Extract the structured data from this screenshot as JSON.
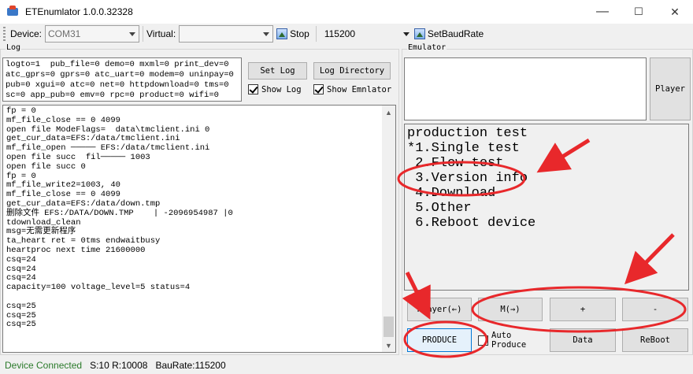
{
  "window": {
    "title": "ETEnumlator 1.0.0.32328",
    "minimize": "—",
    "maximize": "☐",
    "close": "✕"
  },
  "toolbar": {
    "device_label": "Device:",
    "device_value": "COM31",
    "virtual_label": "Virtual:",
    "virtual_value": "",
    "stop_label": "Stop",
    "baud_value": "115200",
    "set_baud_label": "SetBaudRate"
  },
  "log": {
    "group_title": "Log",
    "flags": "logto=1  pub_file=0 demo=0 mxml=0 print_dev=0\natc_gprs=0 gprs=0 atc_uart=0 modem=0 uninpay=0\npub=0 xgui=0 atc=0 net=0 httpdownload=0 tms=0\nsc=0 app_pub=0 emv=0 rpc=0 product=0 wifi=0",
    "set_log": "Set Log",
    "log_directory": "Log Directory",
    "show_log": "Show Log",
    "show_emulator": "Show Emnlator",
    "lines": "fp = 0\nmf_file_close == 0 4099\nopen file ModeFlags=  data\\tmclient.ini 0\nget_cur_data=EFS:/data/tmclient.ini\nmf_file_open ───── EFS:/data/tmclient.ini\nopen file succ  fil───── 1003\nopen file succ 0\nfp = 0\nmf_file_write2=1003, 40\nmf_file_close == 0 4099\nget_cur_data=EFS:/data/down.tmp\n删除文件 EFS:/DATA/DOWN.TMP    | -2096954987 |0\ntdownload_clean\nmsg=无需更新程序\nta_heart ret = 0tms endwaitbusy\nheartproc next time 21600000\ncsq=24\ncsq=24\ncsq=24\ncapacity=100 voltage_level=5 status=4\n\ncsq=25\ncsq=25\ncsq=25"
  },
  "emulator": {
    "group_title": "Emulator",
    "player": "Player",
    "screen": "production test\n*1.Single test\n 2.Flow test\n 3.Version info\n 4.Download\n 5.Other\n 6.Reboot device",
    "buttons": {
      "player_back": "Player(←)",
      "m_next": "M(→)",
      "plus": "+",
      "minus": "-",
      "produce": "PRODUCE",
      "auto_produce": "Auto\nProduce",
      "data": "Data",
      "reboot": "ReBoot"
    }
  },
  "status": {
    "connected": "Device Connected",
    "counts": "S:10 R:10008",
    "baud": "BauRate:115200"
  },
  "colors": {
    "annotation_red": "#e8282b",
    "status_green": "#2a7a2a"
  }
}
